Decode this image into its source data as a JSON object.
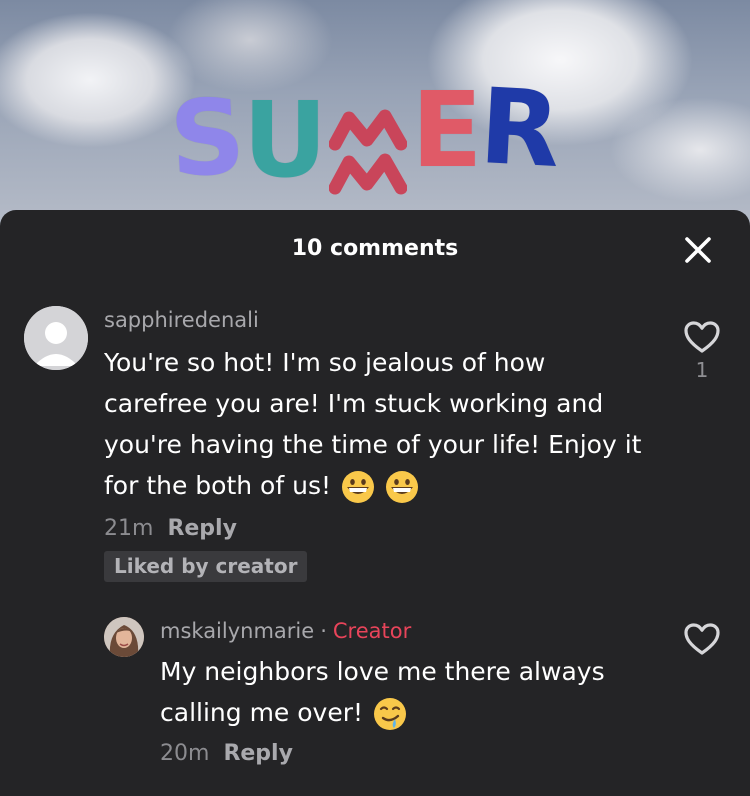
{
  "video": {
    "overlay_letters": [
      "S",
      "U",
      "M",
      "E",
      "R"
    ],
    "overlay_colors": [
      "#8f86ea",
      "#3aa3a0",
      "#c9455a",
      "#e05a67",
      "#1f3aa8"
    ]
  },
  "sheet": {
    "title": "10 comments",
    "close_icon": "close-icon"
  },
  "comments": [
    {
      "username": "sapphiredenali",
      "text": "You're so hot! I'm so jealous of how carefree you are! I'm stuck working and you're having the time of your life! Enjoy it for the both of us!",
      "emojis": [
        "grinning-face-emoji",
        "grinning-face-emoji"
      ],
      "time": "21m",
      "reply_label": "Reply",
      "badge": "Liked by creator",
      "like_count": "1"
    },
    {
      "username": "mskailynmarie",
      "separator": "·",
      "role": "Creator",
      "text": "My neighbors love me there always calling me over!",
      "emojis": [
        "drooling-face-emoji"
      ],
      "time": "20m",
      "reply_label": "Reply"
    }
  ],
  "colors": {
    "background": "#242426",
    "creator_accent": "#e8445a",
    "text_primary": "#ffffff",
    "text_secondary": "#a8a8ac"
  }
}
